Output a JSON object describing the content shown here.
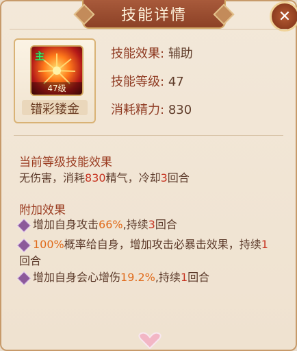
{
  "window": {
    "title": "技能详情",
    "close_icon": "close-icon"
  },
  "skill": {
    "icon": "firework-skill-icon",
    "level_badge": "47级",
    "name": "错彩镂金",
    "corner_glyph": "主"
  },
  "info": [
    {
      "label": "技能效果:",
      "value": "辅助"
    },
    {
      "label": "技能等级:",
      "value": "47"
    },
    {
      "label": "消耗精力:",
      "value": "830"
    }
  ],
  "current_effect": {
    "title": "当前等级技能效果",
    "text_1": "无伤害，消耗",
    "cost": "830",
    "text_2": "精气，冷却",
    "cooldown": "3",
    "text_3": "回合"
  },
  "extra_effect": {
    "title": "附加效果",
    "items": [
      {
        "a": "增加自身攻击",
        "b": "66%",
        "c": ",持续",
        "d": "3",
        "e": "回合"
      },
      {
        "a": "100%",
        "b": "概率给自身，增加攻击必暴击效果，持续",
        "c": "1",
        "d": "回合"
      },
      {
        "a": "增加自身会心增伤",
        "b": "19.2%",
        "c": ",持续",
        "d": "1",
        "e": "回合"
      }
    ]
  },
  "colors": {
    "title_bar": "#a85a3b",
    "label": "#8f3a22",
    "value": "#5f3c2a",
    "highlight_red": "#c6321f",
    "highlight_orange": "#e06a1a"
  }
}
